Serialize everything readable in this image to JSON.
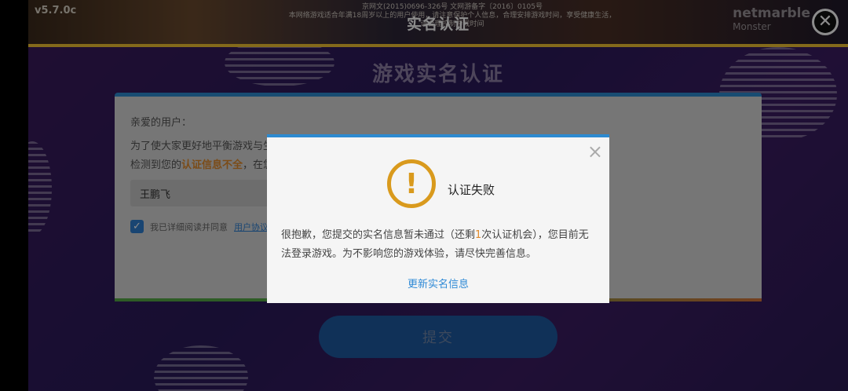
{
  "header": {
    "version": "v5.7.0c",
    "license_lines": [
      "京网文(2015)0696-326号 文网游备字〔2016〕0105号",
      "本网络游戏适合年满18周岁以上的用户使用，请注意保护个人信息，合理安排游戏时间，享受健康生活，请合理控制游戏时间"
    ],
    "title": "实名认证",
    "brand": "netmarble",
    "brand_sub": "Monster",
    "close_symbol": "✕"
  },
  "form": {
    "page_title": "游戏实名认证",
    "greeting": "亲爱的用户：",
    "para1": "为了使大家更好地平衡游戏与生",
    "para2_prefix": "检测到您的",
    "para2_warn": "认证信息不全",
    "para2_suffix": "，在您",
    "name_value": "王鹏飞",
    "agree_text": "我已详细阅读并同意",
    "agree_link": "用户协议",
    "checkbox_symbol": "✓",
    "submit_label": "提交"
  },
  "dialog": {
    "close_symbol": "×",
    "icon_symbol": "!",
    "title": "认证失败",
    "msg_part1": "很抱歉，您提交的实名信息暂未通过（还剩",
    "msg_count": "1",
    "msg_part2": "次认证机会），您目前无法登录游戏。为不影响您的游戏体验，请尽快完善信息。",
    "update_link": "更新实名信息"
  },
  "colors": {
    "accent_blue": "#2d8ad0",
    "warning_gold": "#d99a1d",
    "warning_orange": "#e08a2c",
    "header_gold_line": "#f1c232"
  },
  "icons": {
    "close": "close-icon",
    "dialog_close": "dialog-close-icon",
    "warning": "warning-icon",
    "checkbox": "checkmark-icon"
  }
}
